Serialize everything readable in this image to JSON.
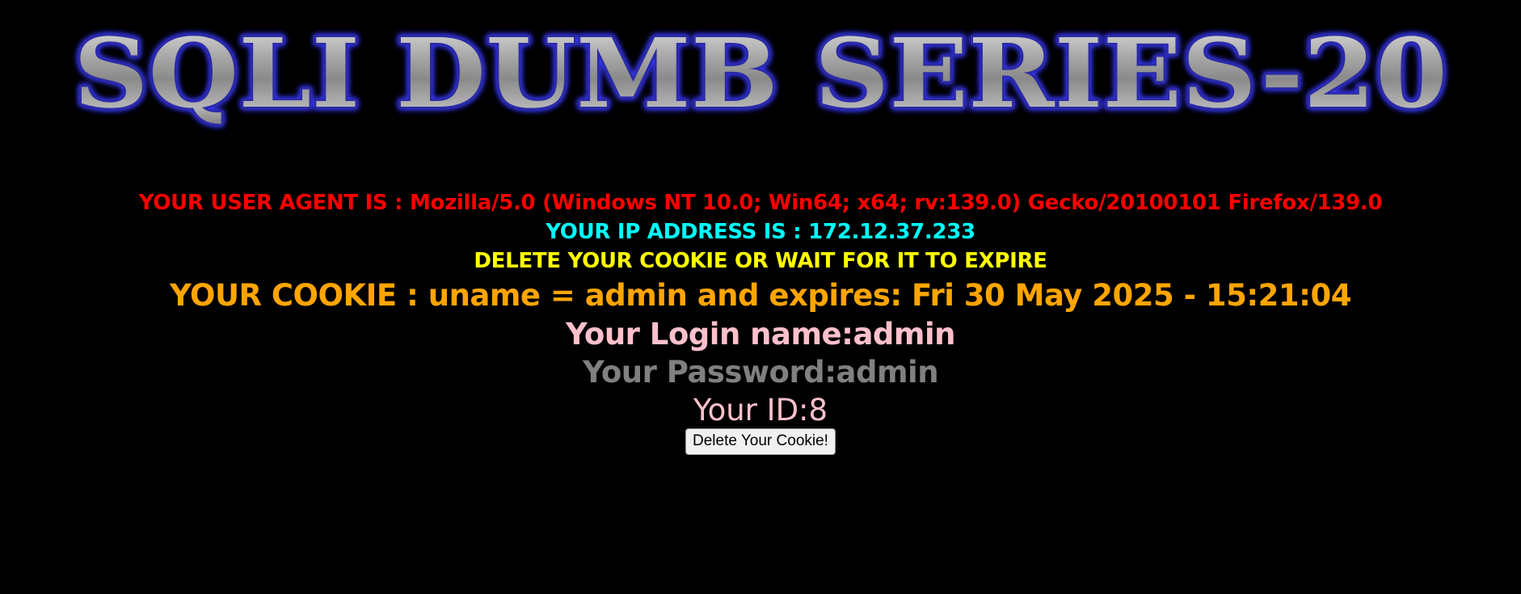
{
  "banner": {
    "title": "SQLI DUMB SERIES-20"
  },
  "info": {
    "user_agent": "YOUR USER AGENT IS : Mozilla/5.0 (Windows NT 10.0; Win64; x64; rv:139.0) Gecko/20100101 Firefox/139.0",
    "ip_address": "YOUR IP ADDRESS IS : 172.12.37.233",
    "delete_message": "DELETE YOUR COOKIE OR WAIT FOR IT TO EXPIRE",
    "cookie": "YOUR COOKIE : uname = admin and expires: Fri 30 May 2025 - 15:21:04",
    "login_name": "Your Login name:admin",
    "password": "Your Password:admin",
    "id": "Your ID:8"
  },
  "actions": {
    "delete_button_label": "Delete Your Cookie!"
  },
  "colors": {
    "background": "#000000",
    "user_agent": "#ff0000",
    "ip": "#00ffff",
    "delete_message": "#ffff00",
    "cookie": "#ffa500",
    "login": "#ffc0cb",
    "password": "#808080",
    "id": "#ffc0cb"
  }
}
